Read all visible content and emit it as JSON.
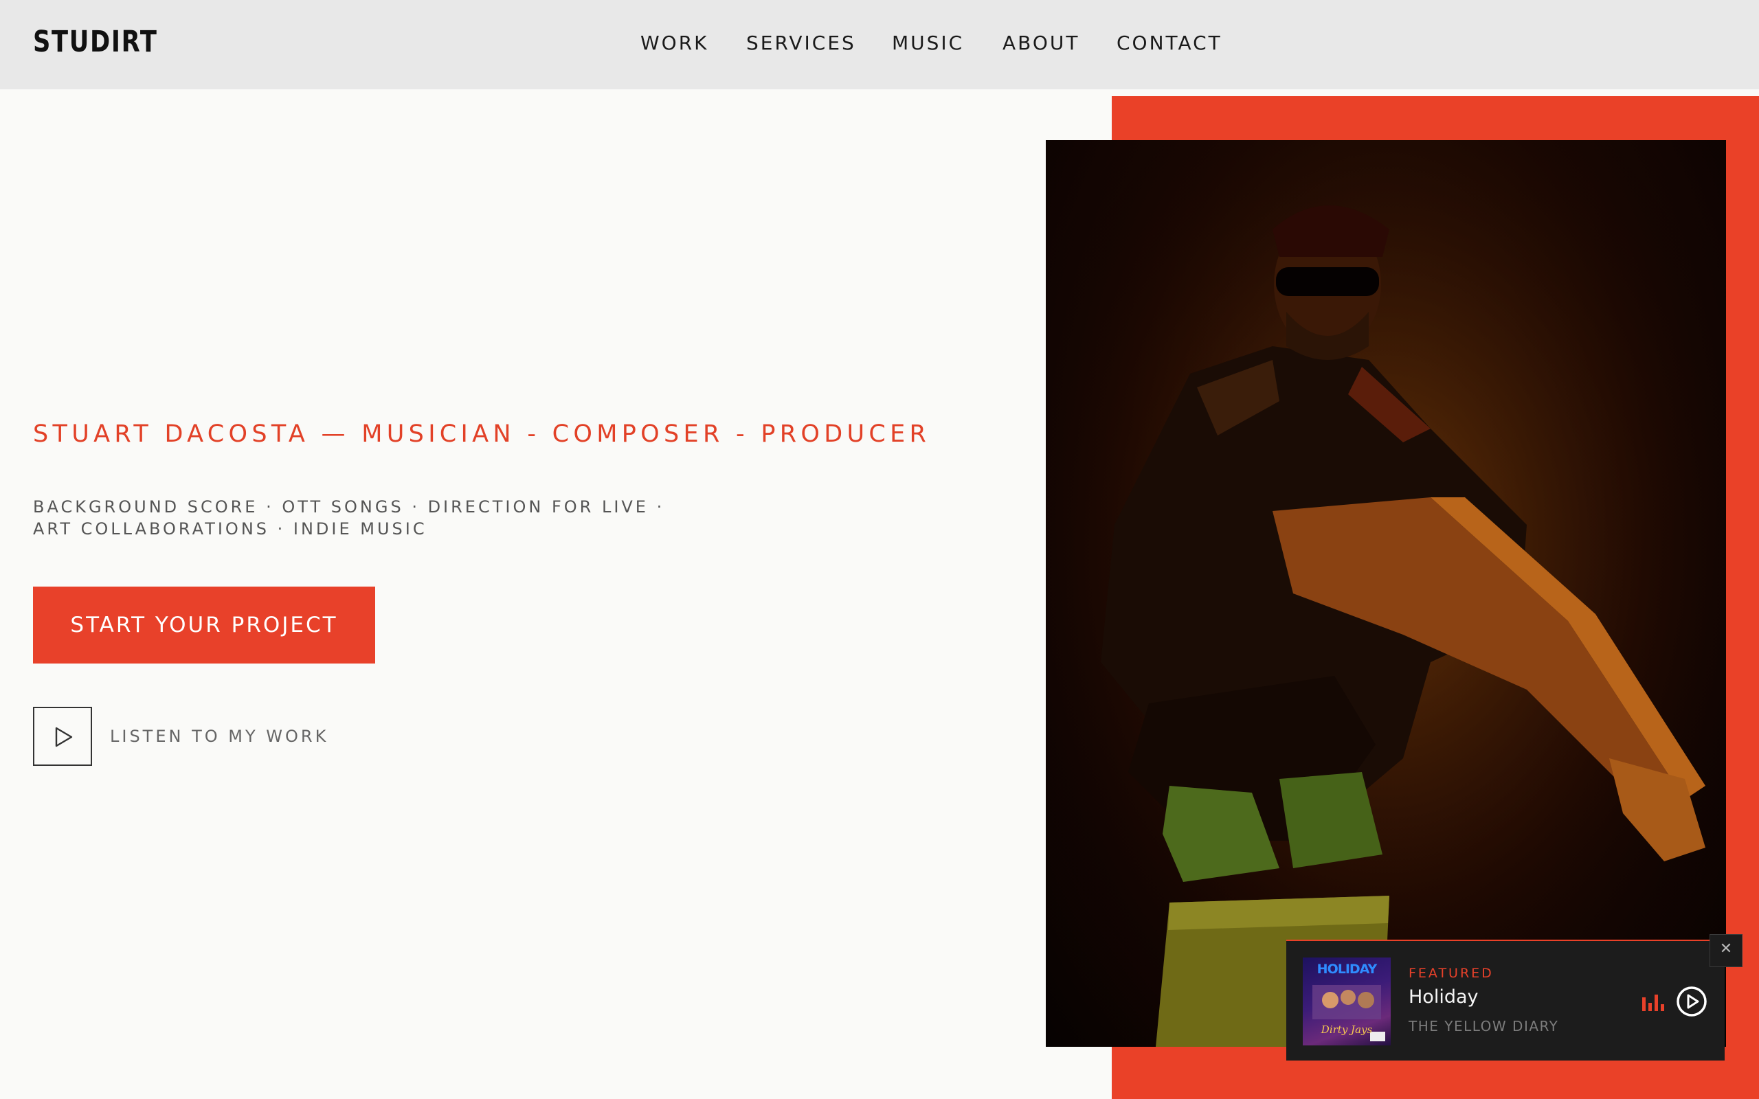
{
  "header": {
    "logo": "STUDIRT",
    "nav": [
      "WORK",
      "SERVICES",
      "MUSIC",
      "ABOUT",
      "CONTACT"
    ]
  },
  "hero": {
    "tagline": "STUART DACOSTA — MUSICIAN - COMPOSER - PRODUCER",
    "services": "BACKGROUND SCORE · OTT SONGS · DIRECTION FOR LIVE · ART COLLABORATIONS · INDIE MUSIC",
    "cta_label": "START YOUR PROJECT",
    "listen_label": "LISTEN TO MY WORK",
    "listen_icon": "play-icon"
  },
  "player": {
    "tag": "FEATURED",
    "title": "Holiday",
    "artist": "THE YELLOW DIARY",
    "cover_title": "HOLIDAY",
    "cover_subtitle": "Dirty Jays",
    "close_icon": "close-icon",
    "eq_icon": "equalizer-icon",
    "play_icon": "play-circle-icon"
  },
  "colors": {
    "accent": "#e8412a",
    "header_bg": "#e8e8e8",
    "page_bg": "#fafaf8",
    "player_bg": "#1c1c1c"
  }
}
